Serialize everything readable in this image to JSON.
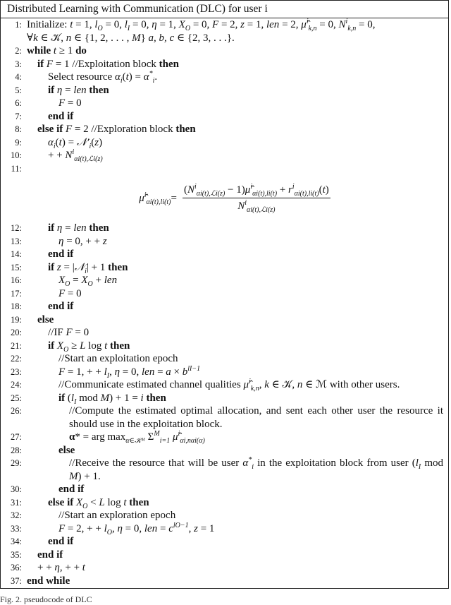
{
  "algorithm": {
    "title": "Distributed Learning with Communication (DLC) for user i",
    "lines": [
      {
        "n": "1:",
        "indent": 0,
        "rows": [
          [
            [
              "r",
              "Initialize: "
            ],
            [
              "m",
              "t"
            ],
            [
              "r",
              " = 1, "
            ],
            [
              "m",
              "l",
              "O"
            ],
            [
              "r",
              " = 0, "
            ],
            [
              "m",
              "l",
              "I"
            ],
            [
              "r",
              " = 0, "
            ],
            [
              "m",
              "η"
            ],
            [
              "r",
              " = 1, "
            ],
            [
              "m",
              "X",
              "O"
            ],
            [
              "r",
              " = 0, "
            ],
            [
              "m",
              "F"
            ],
            [
              "r",
              " = 2, "
            ],
            [
              "m",
              "z"
            ],
            [
              "r",
              " = 1, "
            ],
            [
              "m",
              "len"
            ],
            [
              "r",
              " = 2, "
            ],
            [
              "m",
              "μ̂",
              "k,n",
              "i"
            ],
            [
              "r",
              " = 0, "
            ],
            [
              "m",
              "N",
              "k,n",
              "i"
            ],
            [
              "r",
              " = 0,"
            ]
          ],
          [
            [
              "r",
              "∀"
            ],
            [
              "m",
              "k"
            ],
            [
              "r",
              " ∈ 𝒦, "
            ],
            [
              "m",
              "n"
            ],
            [
              "r",
              " ∈ {1, 2, . . . , "
            ],
            [
              "m",
              "M"
            ],
            [
              "r",
              "} "
            ],
            [
              "m",
              "a, b, c"
            ],
            [
              "r",
              " ∈ {2, 3, . . .}."
            ]
          ]
        ]
      },
      {
        "n": "2:",
        "indent": 0,
        "rows": [
          [
            [
              "b",
              "while "
            ],
            [
              "m",
              "t"
            ],
            [
              "r",
              " ≥ 1 "
            ],
            [
              "b",
              "do"
            ]
          ]
        ]
      },
      {
        "n": "3:",
        "indent": 1,
        "rows": [
          [
            [
              "b",
              "if "
            ],
            [
              "m",
              "F"
            ],
            [
              "r",
              " = 1 //Exploitation block "
            ],
            [
              "b",
              "then"
            ]
          ]
        ]
      },
      {
        "n": "4:",
        "indent": 2,
        "rows": [
          [
            [
              "r",
              "Select resource "
            ],
            [
              "m",
              "α",
              "i"
            ],
            [
              "r",
              "("
            ],
            [
              "m",
              "t"
            ],
            [
              "r",
              ") = "
            ],
            [
              "m",
              "α",
              "i",
              "*"
            ],
            [
              "r",
              "."
            ]
          ]
        ]
      },
      {
        "n": "5:",
        "indent": 2,
        "rows": [
          [
            [
              "b",
              "if "
            ],
            [
              "m",
              "η"
            ],
            [
              "r",
              " = "
            ],
            [
              "m",
              "len"
            ],
            [
              "b",
              " then"
            ]
          ]
        ]
      },
      {
        "n": "6:",
        "indent": 3,
        "rows": [
          [
            [
              "m",
              "F"
            ],
            [
              "r",
              " = 0"
            ]
          ]
        ]
      },
      {
        "n": "7:",
        "indent": 2,
        "rows": [
          [
            [
              "b",
              "end if"
            ]
          ]
        ]
      },
      {
        "n": "8:",
        "indent": 1,
        "rows": [
          [
            [
              "b",
              "else if "
            ],
            [
              "m",
              "F"
            ],
            [
              "r",
              " = 2 //Exploration block "
            ],
            [
              "b",
              "then"
            ]
          ]
        ]
      },
      {
        "n": "9:",
        "indent": 2,
        "rows": [
          [
            [
              "m",
              "α",
              "i"
            ],
            [
              "r",
              "("
            ],
            [
              "m",
              "t"
            ],
            [
              "r",
              ") = "
            ],
            [
              "m",
              "𝒩′",
              "i"
            ],
            [
              "r",
              "("
            ],
            [
              "m",
              "z"
            ],
            [
              "r",
              ")"
            ]
          ]
        ]
      },
      {
        "n": "10:",
        "indent": 2,
        "rows": [
          [
            [
              "r",
              "+ + "
            ],
            [
              "m",
              "N",
              "αi(t),ℒi(z)",
              "i"
            ]
          ]
        ]
      },
      {
        "n": "11:",
        "indent": 2,
        "rows": [
          []
        ],
        "formula": true
      },
      {
        "n": "12:",
        "indent": 2,
        "rows": [
          [
            [
              "b",
              "if "
            ],
            [
              "m",
              "η"
            ],
            [
              "r",
              " = "
            ],
            [
              "m",
              "len"
            ],
            [
              "b",
              " then"
            ]
          ]
        ]
      },
      {
        "n": "13:",
        "indent": 3,
        "rows": [
          [
            [
              "m",
              "η"
            ],
            [
              "r",
              " = 0, + + "
            ],
            [
              "m",
              "z"
            ]
          ]
        ]
      },
      {
        "n": "14:",
        "indent": 2,
        "rows": [
          [
            [
              "b",
              "end if"
            ]
          ]
        ]
      },
      {
        "n": "15:",
        "indent": 2,
        "rows": [
          [
            [
              "b",
              "if "
            ],
            [
              "m",
              "z"
            ],
            [
              "r",
              " = |"
            ],
            [
              "m",
              "𝒩",
              "i"
            ],
            [
              "r",
              "| + 1 "
            ],
            [
              "b",
              "then"
            ]
          ]
        ]
      },
      {
        "n": "16:",
        "indent": 3,
        "rows": [
          [
            [
              "m",
              "X",
              "O"
            ],
            [
              "r",
              " = "
            ],
            [
              "m",
              "X",
              "O"
            ],
            [
              "r",
              " + "
            ],
            [
              "m",
              "len"
            ]
          ]
        ]
      },
      {
        "n": "17:",
        "indent": 3,
        "rows": [
          [
            [
              "m",
              "F"
            ],
            [
              "r",
              " = 0"
            ]
          ]
        ]
      },
      {
        "n": "18:",
        "indent": 2,
        "rows": [
          [
            [
              "b",
              "end if"
            ]
          ]
        ]
      },
      {
        "n": "19:",
        "indent": 1,
        "rows": [
          [
            [
              "b",
              "else"
            ]
          ]
        ]
      },
      {
        "n": "20:",
        "indent": 2,
        "rows": [
          [
            [
              "r",
              "//IF "
            ],
            [
              "m",
              "F"
            ],
            [
              "r",
              " = 0"
            ]
          ]
        ]
      },
      {
        "n": "21:",
        "indent": 2,
        "rows": [
          [
            [
              "b",
              "if "
            ],
            [
              "m",
              "X",
              "O"
            ],
            [
              "r",
              " ≥ "
            ],
            [
              "m",
              "L"
            ],
            [
              "r",
              " log "
            ],
            [
              "m",
              "t"
            ],
            [
              "b",
              " then"
            ]
          ]
        ]
      },
      {
        "n": "22:",
        "indent": 3,
        "rows": [
          [
            [
              "r",
              "//Start an exploitation epoch"
            ]
          ]
        ]
      },
      {
        "n": "23:",
        "indent": 3,
        "rows": [
          [
            [
              "m",
              "F"
            ],
            [
              "r",
              " = 1, + + "
            ],
            [
              "m",
              "l",
              "I"
            ],
            [
              "r",
              ", "
            ],
            [
              "m",
              "η"
            ],
            [
              "r",
              " = 0, "
            ],
            [
              "m",
              "len"
            ],
            [
              "r",
              " = "
            ],
            [
              "m",
              "a"
            ],
            [
              "r",
              " × "
            ],
            [
              "m",
              "b",
              "",
              "lI−1"
            ]
          ]
        ]
      },
      {
        "n": "24:",
        "indent": 3,
        "rows": [
          [
            [
              "r",
              "//Communicate estimated channel qualities "
            ],
            [
              "m",
              "μ̂",
              "k,n",
              "i"
            ],
            [
              "r",
              ", "
            ],
            [
              "m",
              "k"
            ],
            [
              "r",
              " ∈ 𝒦, "
            ],
            [
              "m",
              "n"
            ],
            [
              "r",
              " ∈ ℳ with other users."
            ]
          ]
        ]
      },
      {
        "n": "25:",
        "indent": 3,
        "rows": [
          [
            [
              "b",
              "if "
            ],
            [
              "r",
              " ("
            ],
            [
              "m",
              "l",
              "I"
            ],
            [
              "r",
              "  mod "
            ],
            [
              "m",
              "M"
            ],
            [
              "r",
              ") + 1 = "
            ],
            [
              "m",
              "i"
            ],
            [
              "b",
              " then"
            ]
          ]
        ]
      },
      {
        "n": "26:",
        "indent": 4,
        "rows": [
          [
            [
              "r",
              "//Compute the estimated optimal allocation, and sent each other user the resource it should use in the exploitation block."
            ]
          ]
        ]
      },
      {
        "n": "27:",
        "indent": 4,
        "rows": [
          [
            [
              "b",
              "α"
            ],
            [
              "r",
              "* = arg max"
            ],
            [
              "m",
              "",
              "α∈𝒦ᴹ"
            ],
            [
              "r",
              " Σ"
            ],
            [
              "m",
              "",
              "i=1",
              "M"
            ],
            [
              "r",
              " "
            ],
            [
              "m",
              "μ̂",
              "αi,nαi(α)",
              "i"
            ]
          ]
        ]
      },
      {
        "n": "28:",
        "indent": 3,
        "rows": [
          [
            [
              "b",
              "else"
            ]
          ]
        ]
      },
      {
        "n": "29:",
        "indent": 4,
        "rows": [
          [
            [
              "r",
              "//Receive the resource that will be user "
            ],
            [
              "m",
              "α",
              "i",
              "*"
            ],
            [
              "r",
              " in the exploitation block from user ("
            ],
            [
              "m",
              "l",
              "I"
            ],
            [
              "r",
              " mod "
            ],
            [
              "m",
              "M"
            ],
            [
              "r",
              ") + 1."
            ]
          ]
        ]
      },
      {
        "n": "30:",
        "indent": 3,
        "rows": [
          [
            [
              "b",
              "end if"
            ]
          ]
        ]
      },
      {
        "n": "31:",
        "indent": 2,
        "rows": [
          [
            [
              "b",
              "else if "
            ],
            [
              "m",
              "X",
              "O"
            ],
            [
              "r",
              " < "
            ],
            [
              "m",
              "L"
            ],
            [
              "r",
              " log "
            ],
            [
              "m",
              "t"
            ],
            [
              "b",
              " then"
            ]
          ]
        ]
      },
      {
        "n": "32:",
        "indent": 3,
        "rows": [
          [
            [
              "r",
              "//Start an exploration epoch"
            ]
          ]
        ]
      },
      {
        "n": "33:",
        "indent": 3,
        "rows": [
          [
            [
              "m",
              "F"
            ],
            [
              "r",
              " = 2, + + "
            ],
            [
              "m",
              "l",
              "O"
            ],
            [
              "r",
              ", "
            ],
            [
              "m",
              "η"
            ],
            [
              "r",
              " = 0, "
            ],
            [
              "m",
              "len"
            ],
            [
              "r",
              " = "
            ],
            [
              "m",
              "c",
              "",
              "lO−1"
            ],
            [
              "r",
              ", "
            ],
            [
              "m",
              "z"
            ],
            [
              "r",
              " = 1"
            ]
          ]
        ]
      },
      {
        "n": "34:",
        "indent": 2,
        "rows": [
          [
            [
              "b",
              "end if"
            ]
          ]
        ]
      },
      {
        "n": "35:",
        "indent": 1,
        "rows": [
          [
            [
              "b",
              "end if"
            ]
          ]
        ]
      },
      {
        "n": "36:",
        "indent": 1,
        "rows": [
          [
            [
              "r",
              "+ + "
            ],
            [
              "m",
              "η"
            ],
            [
              "r",
              ", + + "
            ],
            [
              "m",
              "t"
            ]
          ]
        ]
      },
      {
        "n": "37:",
        "indent": 0,
        "rows": [
          [
            [
              "b",
              "end while"
            ]
          ]
        ]
      }
    ],
    "formula": {
      "lhs": [
        "μ̂",
        "αi(t),li(t)",
        "i"
      ],
      "equals": " = ",
      "numerator": [
        [
          "r",
          "("
        ],
        [
          "m",
          "N",
          "αi(t),ℒi(z)",
          "i"
        ],
        [
          "r",
          " − 1)"
        ],
        [
          "m",
          "μ̂",
          "αi(t),li(t)",
          "i"
        ],
        [
          "r",
          " + "
        ],
        [
          "m",
          "r",
          "αi(t),li(t)",
          "i"
        ],
        [
          "r",
          "("
        ],
        [
          "m",
          "t"
        ],
        [
          "r",
          ")"
        ]
      ],
      "denominator": [
        [
          "m",
          "N",
          "αi(t),ℒi(z)",
          "i"
        ]
      ]
    }
  },
  "caption": "Fig. 2.   pseudocode of DLC"
}
